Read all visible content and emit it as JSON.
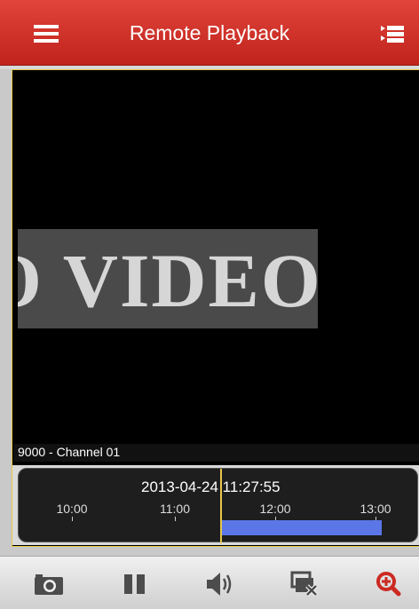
{
  "header": {
    "title": "Remote Playback",
    "menu_icon": "hamburger-icon",
    "list_icon": "list-icon"
  },
  "video": {
    "overlay_text": "O VIDEO",
    "channel_label": "9000 - Channel 01"
  },
  "timeline": {
    "current_time": "2013-04-24 11:27:55",
    "ticks": [
      "10:00",
      "11:00",
      "12:00",
      "13:00"
    ],
    "recording_color": "#5b77e7",
    "cursor_color": "#e7c74a"
  },
  "toolbar": {
    "items": [
      {
        "icon": "camera-icon",
        "action": "capture"
      },
      {
        "icon": "pause-icon",
        "action": "pause"
      },
      {
        "icon": "volume-icon",
        "action": "sound"
      },
      {
        "icon": "stop-playback-icon",
        "action": "stop"
      },
      {
        "icon": "zoom-in-icon",
        "action": "zoom"
      }
    ]
  },
  "colors": {
    "header": "#d2322a",
    "accent_zoom": "#cc2a22"
  }
}
